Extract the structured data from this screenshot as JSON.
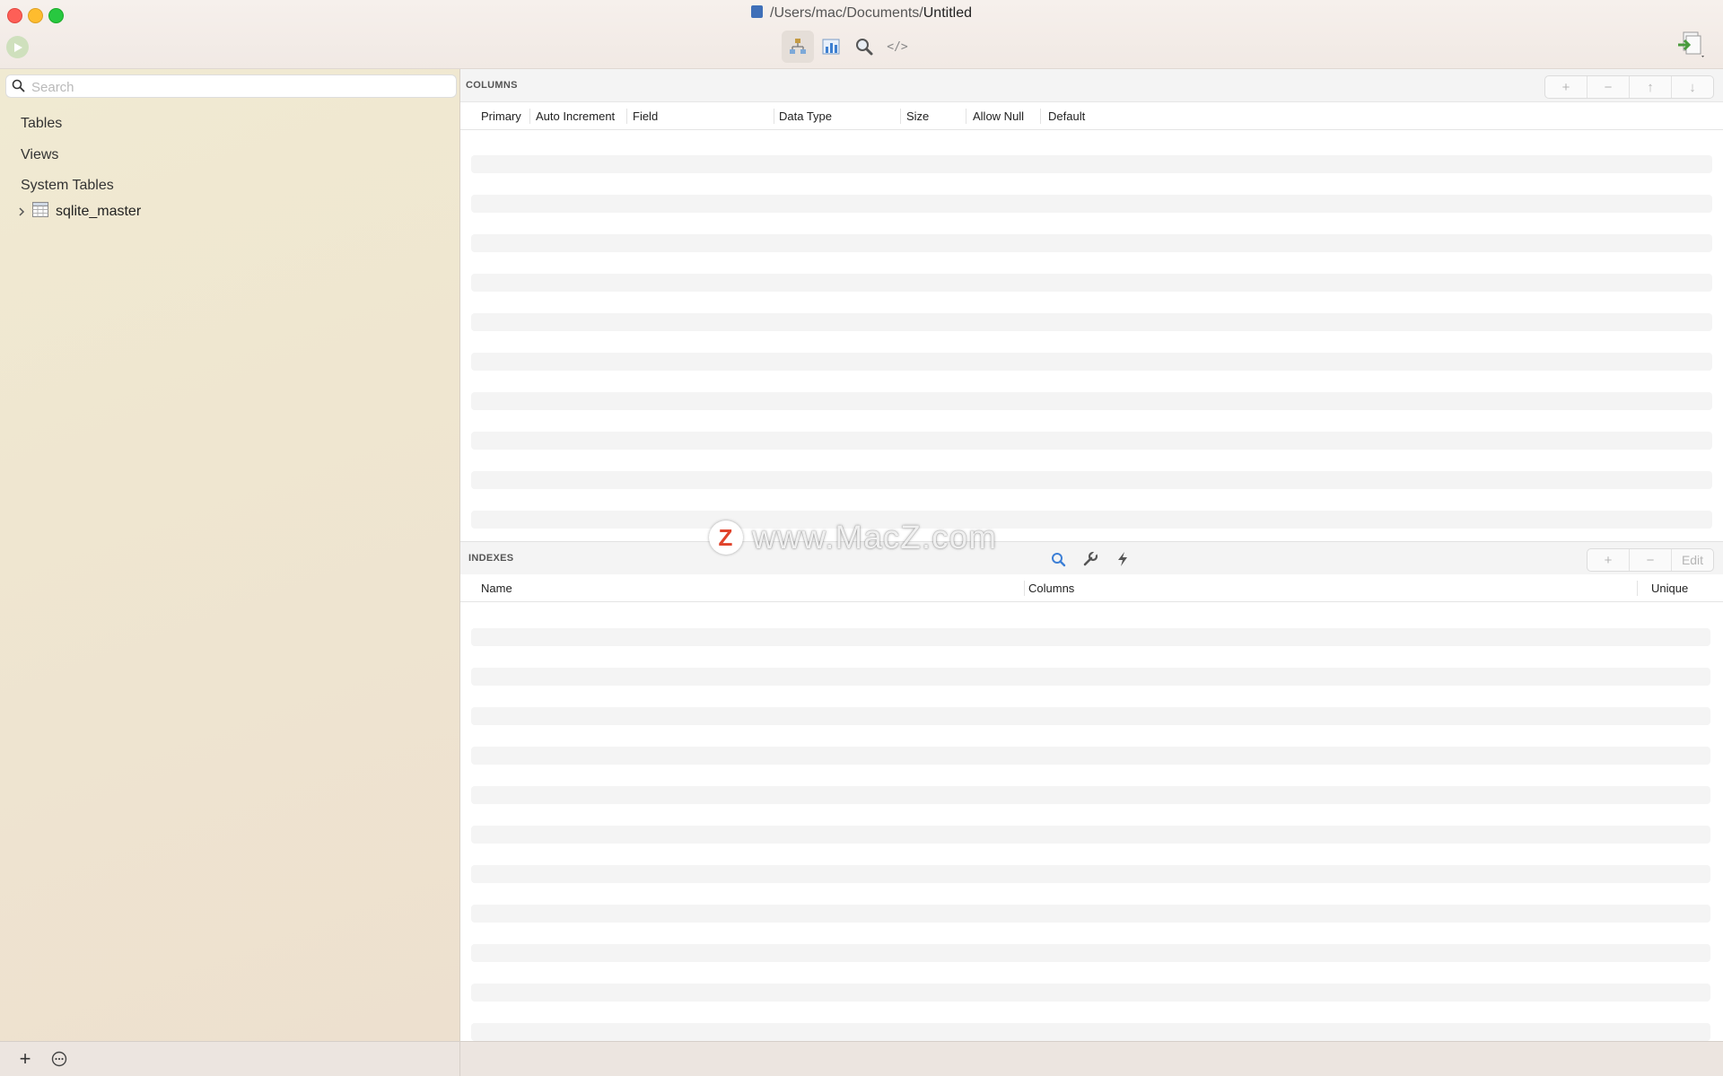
{
  "window": {
    "path": "/Users/mac/Documents/",
    "filename": "Untitled"
  },
  "sidebar": {
    "search_placeholder": "Search",
    "sections": {
      "tables": "Tables",
      "views": "Views",
      "system_tables": "System Tables"
    },
    "system_tables": [
      "sqlite_master"
    ]
  },
  "columns_pane": {
    "title": "COLUMNS",
    "headers": [
      "Primary",
      "Auto Increment",
      "Field",
      "Data Type",
      "Size",
      "Allow Null",
      "Default"
    ],
    "buttons": {
      "add": "+",
      "remove": "−",
      "up": "↑",
      "down": "↓"
    }
  },
  "indexes_pane": {
    "title": "INDEXES",
    "headers": [
      "Name",
      "Columns",
      "Unique"
    ],
    "buttons": {
      "add": "+",
      "remove": "−",
      "edit": "Edit"
    }
  },
  "toolbar": {
    "code_label": "</>",
    "tools": [
      "structure-icon",
      "chart-icon",
      "search-icon",
      "code-icon"
    ]
  },
  "bottombar": {
    "add": "+"
  },
  "watermark": {
    "logo": "Z",
    "text": "www.MacZ.com"
  },
  "colors": {
    "sidebar_bg": "#efe6d0",
    "accent": "#3f6fb8",
    "run": "#cfe0bd"
  }
}
